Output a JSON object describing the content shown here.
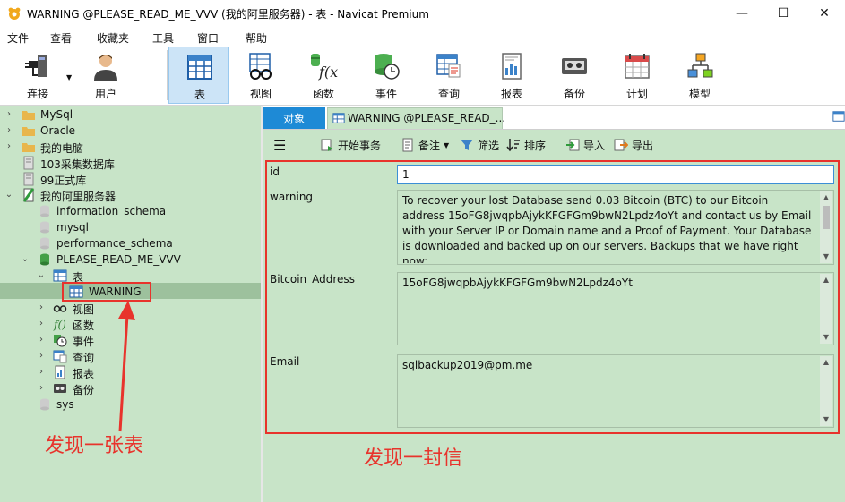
{
  "window": {
    "title": "WARNING @PLEASE_READ_ME_VVV (我的阿里服务器) - 表 - Navicat Premium",
    "minimize": "—",
    "maximize": "☐",
    "close": "✕"
  },
  "menu": [
    "文件",
    "查看",
    "收藏夹",
    "工具",
    "窗口",
    "帮助"
  ],
  "toolbar": {
    "items": [
      {
        "label": "连接",
        "icon": "plug-connect-icon"
      },
      {
        "label": "用户",
        "icon": "user-icon"
      },
      {
        "label": "表",
        "icon": "table-icon",
        "active": true
      },
      {
        "label": "视图",
        "icon": "view-glasses-icon"
      },
      {
        "label": "函数",
        "icon": "function-icon"
      },
      {
        "label": "事件",
        "icon": "event-clock-icon"
      },
      {
        "label": "查询",
        "icon": "query-icon"
      },
      {
        "label": "报表",
        "icon": "report-icon"
      },
      {
        "label": "备份",
        "icon": "backup-tape-icon"
      },
      {
        "label": "计划",
        "icon": "calendar-icon"
      },
      {
        "label": "模型",
        "icon": "model-icon"
      }
    ]
  },
  "sidebar": {
    "tree": [
      {
        "label": "MySql",
        "level": 0,
        "expanded": false,
        "icon": "folder-icon"
      },
      {
        "label": "Oracle",
        "level": 0,
        "expanded": false,
        "icon": "folder-icon"
      },
      {
        "label": "我的电脑",
        "level": 0,
        "expanded": false,
        "icon": "folder-icon"
      },
      {
        "label": "103采集数据库",
        "level": 0,
        "icon": "server-off-icon"
      },
      {
        "label": "99正式库",
        "level": 0,
        "icon": "server-off-icon"
      },
      {
        "label": "我的阿里服务器",
        "level": 0,
        "expanded": true,
        "icon": "server-on-icon"
      },
      {
        "label": "information_schema",
        "level": 1,
        "icon": "database-off-icon"
      },
      {
        "label": "mysql",
        "level": 1,
        "icon": "database-off-icon"
      },
      {
        "label": "performance_schema",
        "level": 1,
        "icon": "database-off-icon"
      },
      {
        "label": "PLEASE_READ_ME_VVV",
        "level": 1,
        "expanded": true,
        "icon": "database-on-icon"
      },
      {
        "label": "表",
        "level": 2,
        "expanded": true,
        "icon": "table-folder-icon"
      },
      {
        "label": "WARNING",
        "level": 3,
        "icon": "table-icon",
        "selected": true
      },
      {
        "label": "视图",
        "level": 2,
        "expanded": false,
        "icon": "view-glasses-icon"
      },
      {
        "label": "函数",
        "level": 2,
        "expanded": false,
        "icon": "function-icon"
      },
      {
        "label": "事件",
        "level": 2,
        "expanded": false,
        "icon": "event-clock-icon"
      },
      {
        "label": "查询",
        "level": 2,
        "expanded": false,
        "icon": "query-icon"
      },
      {
        "label": "报表",
        "level": 2,
        "expanded": false,
        "icon": "report-icon"
      },
      {
        "label": "备份",
        "level": 2,
        "expanded": false,
        "icon": "backup-tape-icon"
      },
      {
        "label": "sys",
        "level": 1,
        "icon": "database-off-icon"
      }
    ]
  },
  "tabs": {
    "objects": "对象",
    "current": "WARNING @PLEASE_READ_..."
  },
  "subtoolbar": {
    "begin_transaction": "开始事务",
    "memo": "备注",
    "filter": "筛选",
    "sort": "排序",
    "import": "导入",
    "export": "导出"
  },
  "form": {
    "fields": [
      {
        "label": "id",
        "value": "1"
      },
      {
        "label": "warning",
        "value": "To recover your lost Database send 0.03 Bitcoin (BTC) to our Bitcoin address 15oFG8jwqpbAjykKFGFGm9bwN2Lpdz4oYt and contact us by Email with your Server IP or Domain name and a Proof of Payment. Your Database is downloaded and backed up on our servers. Backups that we have right now:"
      },
      {
        "label": "Bitcoin_Address",
        "value": "15oFG8jwqpbAjykKFGFGm9bwN2Lpdz4oYt"
      },
      {
        "label": "Email",
        "value": "sqlbackup2019@pm.me"
      }
    ]
  },
  "annotations": {
    "found_table": "发现一张表",
    "found_letter": "发现一封信"
  },
  "colors": {
    "sidebar_bg": "#c8e4c8",
    "selected_row": "#9dc19d",
    "accent_blue": "#1e8ad6",
    "annotation_red": "#e8332c"
  }
}
